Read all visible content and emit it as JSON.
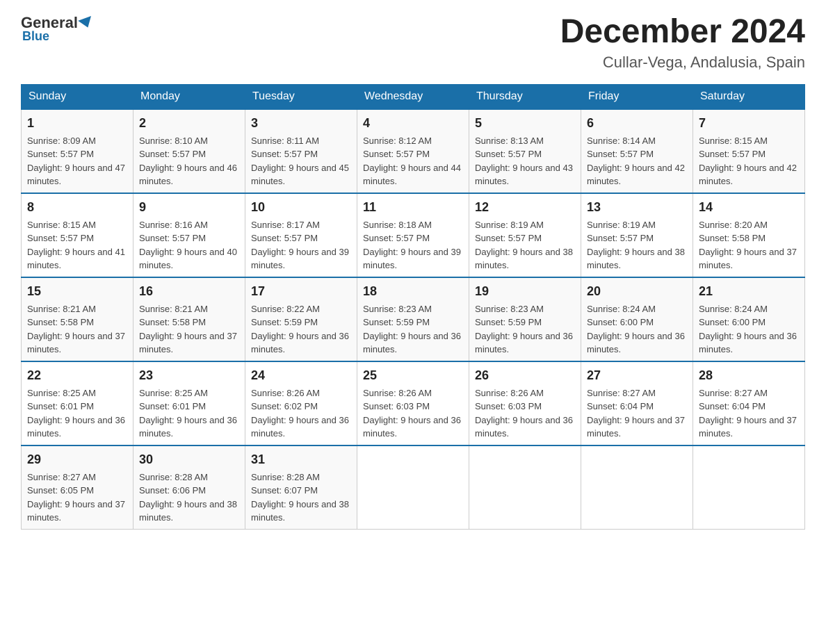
{
  "logo": {
    "general": "General",
    "blue": "Blue"
  },
  "header": {
    "month": "December 2024",
    "location": "Cullar-Vega, Andalusia, Spain"
  },
  "days": [
    "Sunday",
    "Monday",
    "Tuesday",
    "Wednesday",
    "Thursday",
    "Friday",
    "Saturday"
  ],
  "weeks": [
    [
      {
        "num": "1",
        "sunrise": "8:09 AM",
        "sunset": "5:57 PM",
        "daylight": "9 hours and 47 minutes."
      },
      {
        "num": "2",
        "sunrise": "8:10 AM",
        "sunset": "5:57 PM",
        "daylight": "9 hours and 46 minutes."
      },
      {
        "num": "3",
        "sunrise": "8:11 AM",
        "sunset": "5:57 PM",
        "daylight": "9 hours and 45 minutes."
      },
      {
        "num": "4",
        "sunrise": "8:12 AM",
        "sunset": "5:57 PM",
        "daylight": "9 hours and 44 minutes."
      },
      {
        "num": "5",
        "sunrise": "8:13 AM",
        "sunset": "5:57 PM",
        "daylight": "9 hours and 43 minutes."
      },
      {
        "num": "6",
        "sunrise": "8:14 AM",
        "sunset": "5:57 PM",
        "daylight": "9 hours and 42 minutes."
      },
      {
        "num": "7",
        "sunrise": "8:15 AM",
        "sunset": "5:57 PM",
        "daylight": "9 hours and 42 minutes."
      }
    ],
    [
      {
        "num": "8",
        "sunrise": "8:15 AM",
        "sunset": "5:57 PM",
        "daylight": "9 hours and 41 minutes."
      },
      {
        "num": "9",
        "sunrise": "8:16 AM",
        "sunset": "5:57 PM",
        "daylight": "9 hours and 40 minutes."
      },
      {
        "num": "10",
        "sunrise": "8:17 AM",
        "sunset": "5:57 PM",
        "daylight": "9 hours and 39 minutes."
      },
      {
        "num": "11",
        "sunrise": "8:18 AM",
        "sunset": "5:57 PM",
        "daylight": "9 hours and 39 minutes."
      },
      {
        "num": "12",
        "sunrise": "8:19 AM",
        "sunset": "5:57 PM",
        "daylight": "9 hours and 38 minutes."
      },
      {
        "num": "13",
        "sunrise": "8:19 AM",
        "sunset": "5:57 PM",
        "daylight": "9 hours and 38 minutes."
      },
      {
        "num": "14",
        "sunrise": "8:20 AM",
        "sunset": "5:58 PM",
        "daylight": "9 hours and 37 minutes."
      }
    ],
    [
      {
        "num": "15",
        "sunrise": "8:21 AM",
        "sunset": "5:58 PM",
        "daylight": "9 hours and 37 minutes."
      },
      {
        "num": "16",
        "sunrise": "8:21 AM",
        "sunset": "5:58 PM",
        "daylight": "9 hours and 37 minutes."
      },
      {
        "num": "17",
        "sunrise": "8:22 AM",
        "sunset": "5:59 PM",
        "daylight": "9 hours and 36 minutes."
      },
      {
        "num": "18",
        "sunrise": "8:23 AM",
        "sunset": "5:59 PM",
        "daylight": "9 hours and 36 minutes."
      },
      {
        "num": "19",
        "sunrise": "8:23 AM",
        "sunset": "5:59 PM",
        "daylight": "9 hours and 36 minutes."
      },
      {
        "num": "20",
        "sunrise": "8:24 AM",
        "sunset": "6:00 PM",
        "daylight": "9 hours and 36 minutes."
      },
      {
        "num": "21",
        "sunrise": "8:24 AM",
        "sunset": "6:00 PM",
        "daylight": "9 hours and 36 minutes."
      }
    ],
    [
      {
        "num": "22",
        "sunrise": "8:25 AM",
        "sunset": "6:01 PM",
        "daylight": "9 hours and 36 minutes."
      },
      {
        "num": "23",
        "sunrise": "8:25 AM",
        "sunset": "6:01 PM",
        "daylight": "9 hours and 36 minutes."
      },
      {
        "num": "24",
        "sunrise": "8:26 AM",
        "sunset": "6:02 PM",
        "daylight": "9 hours and 36 minutes."
      },
      {
        "num": "25",
        "sunrise": "8:26 AM",
        "sunset": "6:03 PM",
        "daylight": "9 hours and 36 minutes."
      },
      {
        "num": "26",
        "sunrise": "8:26 AM",
        "sunset": "6:03 PM",
        "daylight": "9 hours and 36 minutes."
      },
      {
        "num": "27",
        "sunrise": "8:27 AM",
        "sunset": "6:04 PM",
        "daylight": "9 hours and 37 minutes."
      },
      {
        "num": "28",
        "sunrise": "8:27 AM",
        "sunset": "6:04 PM",
        "daylight": "9 hours and 37 minutes."
      }
    ],
    [
      {
        "num": "29",
        "sunrise": "8:27 AM",
        "sunset": "6:05 PM",
        "daylight": "9 hours and 37 minutes."
      },
      {
        "num": "30",
        "sunrise": "8:28 AM",
        "sunset": "6:06 PM",
        "daylight": "9 hours and 38 minutes."
      },
      {
        "num": "31",
        "sunrise": "8:28 AM",
        "sunset": "6:07 PM",
        "daylight": "9 hours and 38 minutes."
      },
      null,
      null,
      null,
      null
    ]
  ]
}
